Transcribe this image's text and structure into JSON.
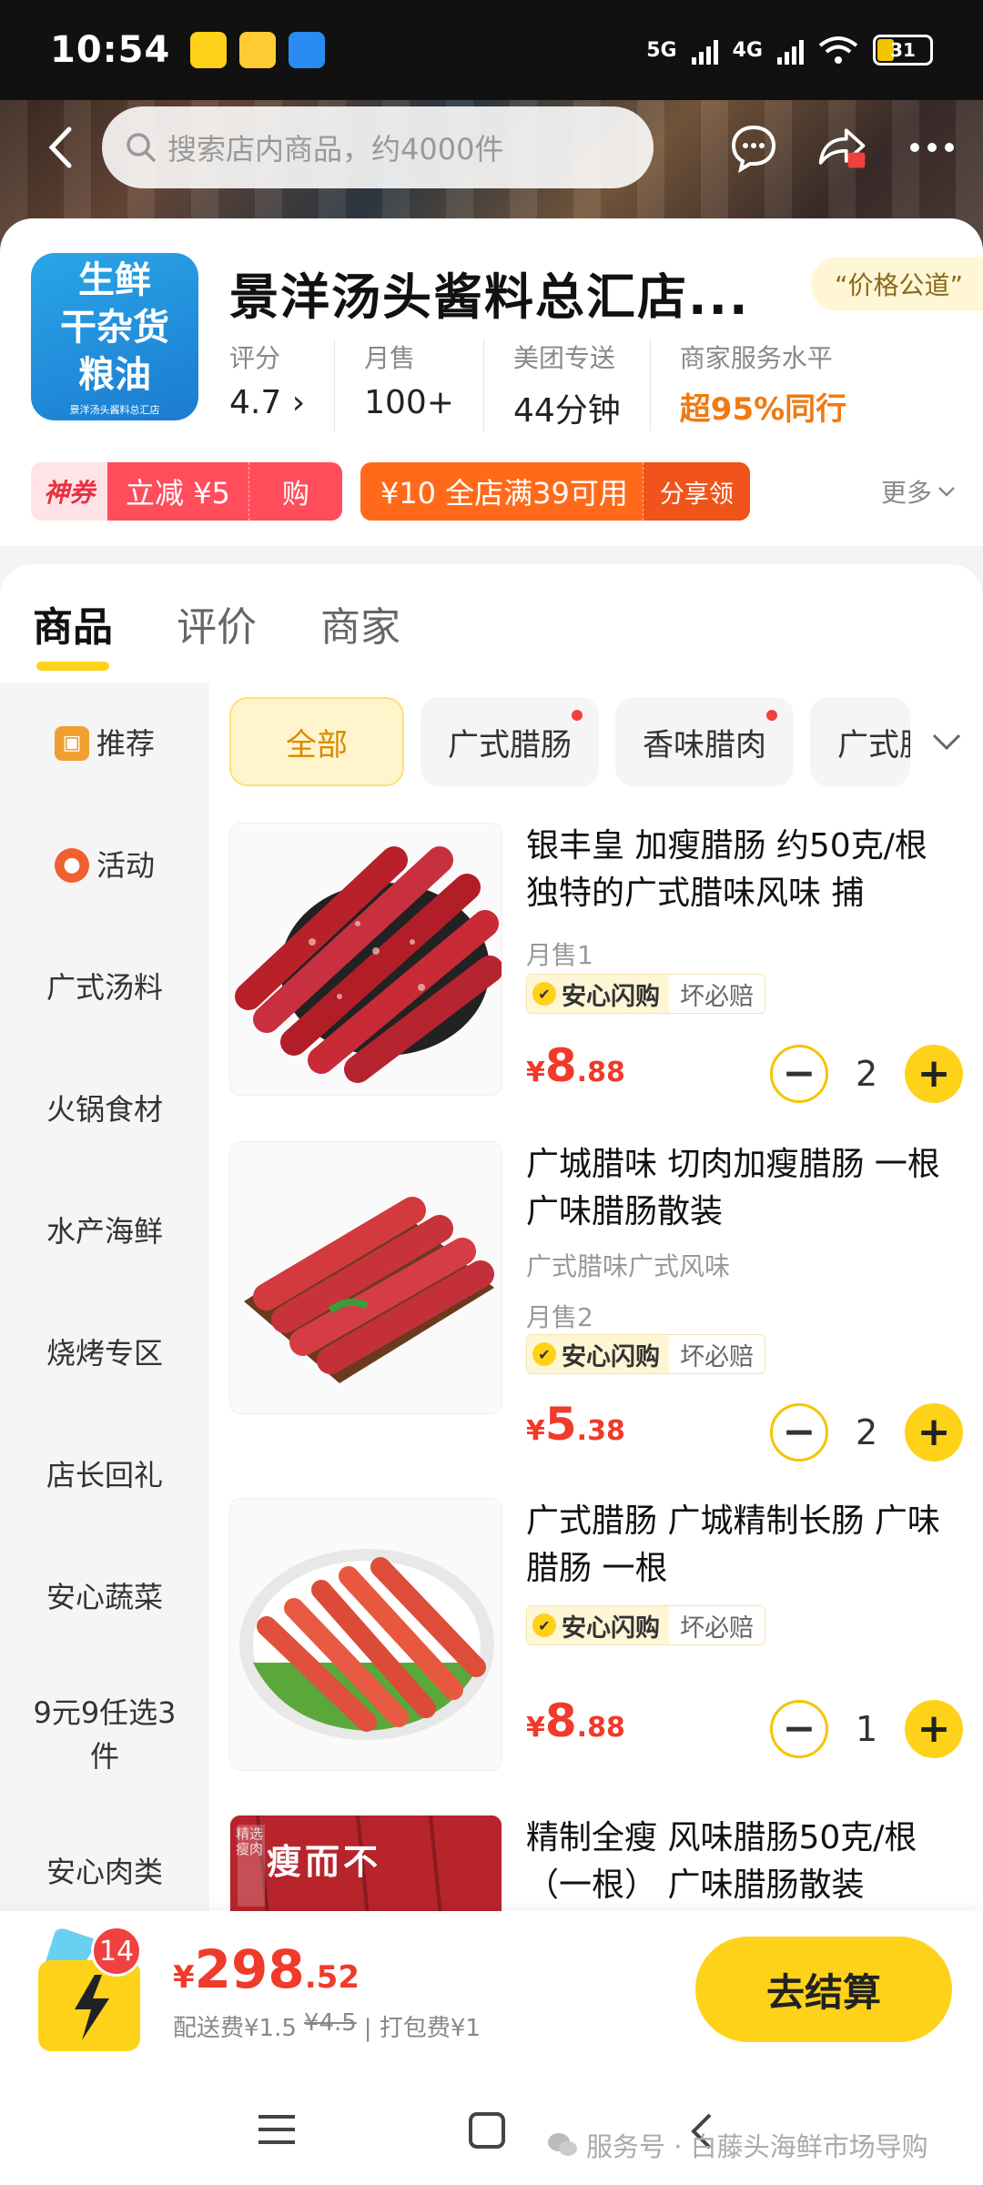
{
  "status_bar": {
    "time": "10:54",
    "net1": "5G",
    "net2": "4G",
    "battery": "31"
  },
  "search": {
    "placeholder": "搜索店内商品，约4000件"
  },
  "store": {
    "logo_lines": [
      "生鲜",
      "干杂货",
      "粮油"
    ],
    "logo_small": "景洋汤头酱料总汇店",
    "name": "景洋汤头酱料总汇店...",
    "fair_badge": "“价格公道”",
    "stats": [
      {
        "label": "评分",
        "value": "4.7 ›"
      },
      {
        "label": "月售",
        "value": "100+"
      },
      {
        "label": "美团专送",
        "value": "44分钟"
      },
      {
        "label": "商家服务水平",
        "value": "超95%同行"
      }
    ],
    "coupon1": {
      "tag": "神券",
      "amount": "立减 ¥5",
      "action": "购"
    },
    "coupon2": {
      "amount": "¥10 全店满39可用",
      "action": "分享领"
    },
    "more": "更多"
  },
  "tabs": [
    "商品",
    "评价",
    "商家"
  ],
  "categories": [
    "推荐",
    "活动",
    "广式汤料",
    "火锅食材",
    "水产海鲜",
    "烧烤专区",
    "店长回礼",
    "安心蔬菜",
    "9元9任选3件",
    "安心肉类"
  ],
  "chips": [
    "全部",
    "广式腊肠",
    "香味腊肉",
    "广式腊"
  ],
  "badge": {
    "main": "安心闪购",
    "sub": "坏必赔"
  },
  "products": [
    {
      "title": "银丰皇 加瘦腊肠 约50克/根 独特的广式腊味风味 捕",
      "subtitle": "",
      "sales": "月售1",
      "currency": "¥",
      "price_int": "8",
      "price_dec": ".88",
      "qty": "2"
    },
    {
      "title": "广城腊味 切肉加瘦腊肠 一根 广味腊肠散装",
      "subtitle": "广式腊味广式风味",
      "sales": "月售2",
      "currency": "¥",
      "price_int": "5",
      "price_dec": ".38",
      "qty": "2"
    },
    {
      "title": "广式腊肠 广城精制长肠 广味腊肠 一根",
      "subtitle": "",
      "sales": "",
      "currency": "¥",
      "price_int": "8",
      "price_dec": ".88",
      "qty": "1"
    },
    {
      "title": "精制全瘦 风味腊肠50克/根（一根） 广味腊肠散装",
      "img_text": "瘦而不",
      "img_tag": "精选瘦肉"
    }
  ],
  "cart": {
    "count": "14",
    "currency": "¥",
    "total_int": "298",
    "total_dec": ".52",
    "fee_label": "配送费¥1.5",
    "fee_old": "¥4.5",
    "pack": "| 打包费¥1",
    "checkout": "去结算"
  },
  "watermark": "服务号 · 白藤头海鲜市场导购",
  "colors": {
    "accent": "#ffd21a",
    "price": "#f03a2a",
    "coupon_red": "#ff4d5c",
    "coupon_orange": "#ff6a1a"
  }
}
